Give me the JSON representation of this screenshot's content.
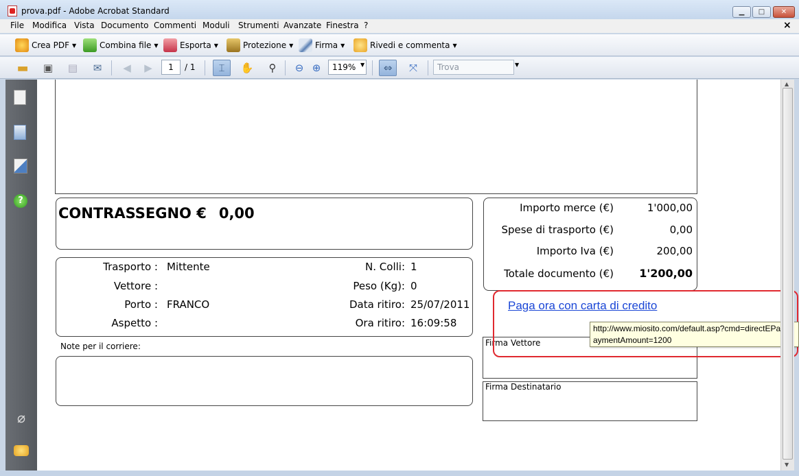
{
  "window": {
    "title": "prova.pdf - Adobe Acrobat Standard",
    "min_label": "▁",
    "max_label": "□",
    "close_label": "✕"
  },
  "menu": {
    "items": [
      "File",
      "Modifica",
      "Vista",
      "Documento",
      "Commenti",
      "Moduli",
      "Strumenti",
      "Avanzate",
      "Finestra",
      "?"
    ],
    "close_label": "×"
  },
  "toolbar1": {
    "items": [
      {
        "label": "Crea PDF",
        "icon": "create-pdf-icon"
      },
      {
        "label": "Combina file",
        "icon": "combine-files-icon"
      },
      {
        "label": "Esporta",
        "icon": "export-icon"
      },
      {
        "label": "Protezione",
        "icon": "lock-icon"
      },
      {
        "label": "Firma",
        "icon": "pen-icon"
      },
      {
        "label": "Rivedi e commenta",
        "icon": "comment-icon"
      }
    ]
  },
  "toolbar2": {
    "page_current": "1",
    "page_total": "/ 1",
    "zoom": "119%",
    "find_placeholder": "Trova"
  },
  "document": {
    "contrassegno_label": "CONTRASSEGNO €",
    "contrassegno_value": "0,00",
    "trasporto_label": "Trasporto :",
    "trasporto_value": "Mittente",
    "vettore_label": "Vettore :",
    "porto_label": "Porto :",
    "porto_value": "FRANCO",
    "aspetto_label": "Aspetto :",
    "colli_label": "N. Colli:",
    "colli_value": "1",
    "peso_label": "Peso (Kg):",
    "peso_value": "0",
    "data_ritiro_label": "Data ritiro:",
    "data_ritiro_value": "25/07/2011",
    "ora_ritiro_label": "Ora ritiro:",
    "ora_ritiro_value": "16:09:58",
    "note_label": "Note  per il corriere:",
    "totals": [
      {
        "label": "Importo merce (€)",
        "value": "1'000,00"
      },
      {
        "label": "Spese di trasporto (€)",
        "value": "0,00"
      },
      {
        "label": "Importo Iva (€)",
        "value": "200,00"
      },
      {
        "label": "Totale documento (€)",
        "value": "1'200,00"
      }
    ],
    "pay_link": "Paga ora con carta di credito",
    "tooltip_line1": "http://www.miosito.com/default.asp?cmd=directEPa",
    "tooltip_line2": "aymentAmount=1200",
    "firma_vettore": "Firma Vettore",
    "firma_destinatario": "Firma Destinatario"
  },
  "colors": {
    "link": "#1a46d6",
    "highlight": "#e0282f",
    "tooltip_bg": "#ffffe1"
  }
}
